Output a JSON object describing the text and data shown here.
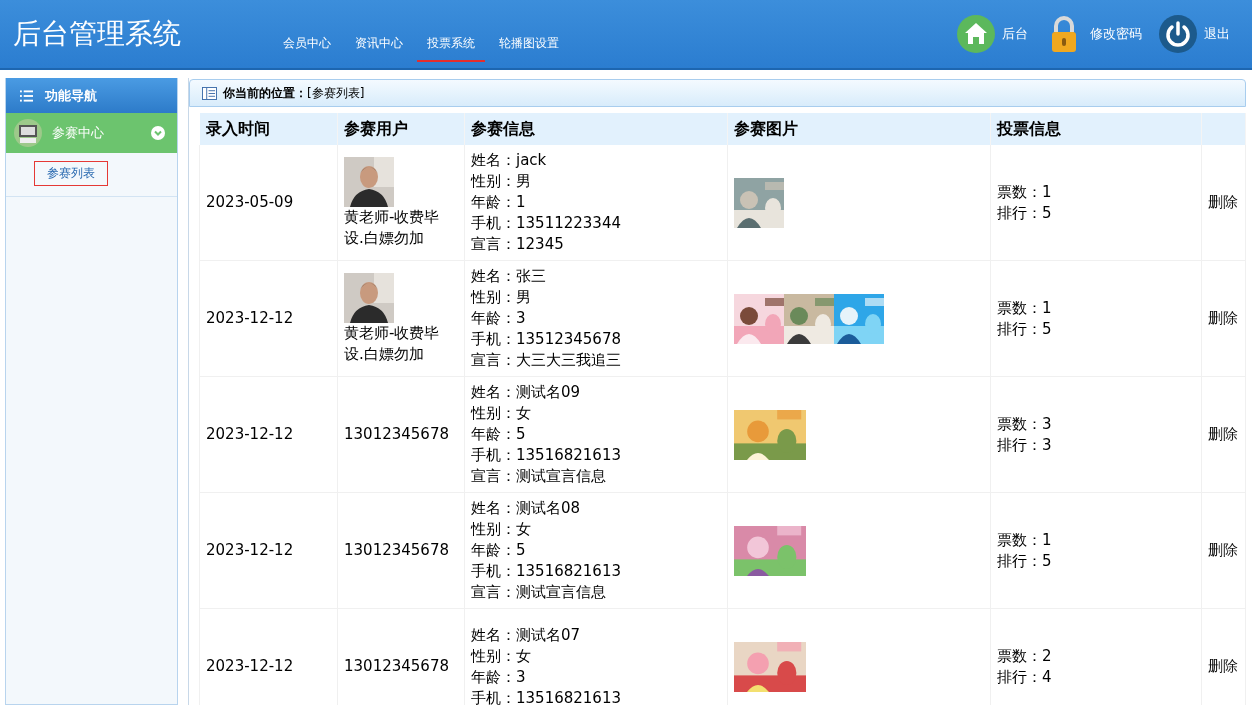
{
  "header": {
    "title": "后台管理系统",
    "nav": [
      {
        "label": "会员中心",
        "selected": false
      },
      {
        "label": "资讯中心",
        "selected": false
      },
      {
        "label": "投票系统",
        "selected": true
      },
      {
        "label": "轮播图设置",
        "selected": false
      }
    ],
    "actions": [
      {
        "kind": "home",
        "label": "后台"
      },
      {
        "kind": "lock",
        "label": "修改密码"
      },
      {
        "kind": "power",
        "label": "退出"
      }
    ]
  },
  "sidebar": {
    "title": "功能导航",
    "groups": [
      {
        "label": "参赛中心",
        "expanded": true,
        "children": [
          {
            "label": "参赛列表",
            "selected": true
          }
        ]
      }
    ]
  },
  "breadcrumb": {
    "label": "你当前的位置：",
    "path": "[参赛列表]"
  },
  "table": {
    "columns": [
      "录入时间",
      "参赛用户",
      "参赛信息",
      "参赛图片",
      "投票信息",
      ""
    ],
    "rows": [
      {
        "time": "2023-05-09",
        "user": {
          "avatar": {
            "kind": "picture"
          },
          "name": "黄老师-收费毕设.白嫖勿加"
        },
        "info": [
          {
            "label": "姓名：",
            "value": "jack"
          },
          {
            "label": "性别：",
            "value": "男"
          },
          {
            "label": "年龄：",
            "value": "1"
          },
          {
            "label": "手机：",
            "value": "13511223344"
          },
          {
            "label": "宣言：",
            "value": "12345"
          }
        ],
        "photos": [
          {
            "kind": "picture"
          }
        ],
        "votes": [
          {
            "label": "票数：",
            "value": "1"
          },
          {
            "label": "排行：",
            "value": "5"
          }
        ],
        "action": "删除"
      },
      {
        "time": "2023-12-12",
        "user": {
          "avatar": {
            "kind": "picture"
          },
          "name": "黄老师-收费毕设.白嫖勿加"
        },
        "info": [
          {
            "label": "姓名：",
            "value": "张三"
          },
          {
            "label": "性别：",
            "value": "男"
          },
          {
            "label": "年龄：",
            "value": "3"
          },
          {
            "label": "手机：",
            "value": "13512345678"
          },
          {
            "label": "宣言：",
            "value": "大三大三我追三"
          }
        ],
        "photos": [
          {
            "kind": "picture"
          },
          {
            "kind": "picture"
          },
          {
            "kind": "picture"
          }
        ],
        "votes": [
          {
            "label": "票数：",
            "value": "1"
          },
          {
            "label": "排行：",
            "value": "5"
          }
        ],
        "action": "删除"
      },
      {
        "time": "2023-12-12",
        "user": {
          "name": "13012345678"
        },
        "info": [
          {
            "label": "姓名：",
            "value": "测试名09"
          },
          {
            "label": "性别：",
            "value": "女"
          },
          {
            "label": "年龄：",
            "value": "5"
          },
          {
            "label": "手机：",
            "value": "13516821613"
          },
          {
            "label": "宣言：",
            "value": "测试宣言信息"
          }
        ],
        "photos": [
          {
            "kind": "picture"
          }
        ],
        "votes": [
          {
            "label": "票数：",
            "value": "3"
          },
          {
            "label": "排行：",
            "value": "3"
          }
        ],
        "action": "删除"
      },
      {
        "time": "2023-12-12",
        "user": {
          "name": "13012345678"
        },
        "info": [
          {
            "label": "姓名：",
            "value": "测试名08"
          },
          {
            "label": "性别：",
            "value": "女"
          },
          {
            "label": "年龄：",
            "value": "5"
          },
          {
            "label": "手机：",
            "value": "13516821613"
          },
          {
            "label": "宣言：",
            "value": "测试宣言信息"
          }
        ],
        "photos": [
          {
            "kind": "picture"
          }
        ],
        "votes": [
          {
            "label": "票数：",
            "value": "1"
          },
          {
            "label": "排行：",
            "value": "5"
          }
        ],
        "action": "删除"
      },
      {
        "time": "2023-12-12",
        "user": {
          "name": "13012345678"
        },
        "info": [
          {
            "label": "姓名：",
            "value": "测试名07"
          },
          {
            "label": "性别：",
            "value": "女"
          },
          {
            "label": "年龄：",
            "value": "3"
          },
          {
            "label": "手机：",
            "value": "13516821613"
          }
        ],
        "photos": [
          {
            "kind": "picture"
          }
        ],
        "votes": [
          {
            "label": "票数：",
            "value": "2"
          },
          {
            "label": "排行：",
            "value": "4"
          }
        ],
        "action": "删除"
      }
    ]
  }
}
